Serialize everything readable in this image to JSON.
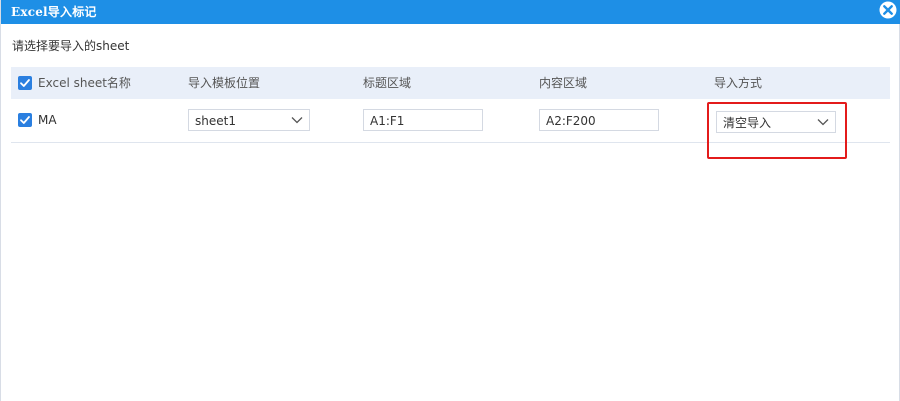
{
  "dialog": {
    "title": "Excel导入标记",
    "instruction": "请选择要导入的sheet"
  },
  "table": {
    "headers": {
      "sheet_name": "Excel sheet名称",
      "template_position": "导入模板位置",
      "title_area": "标题区域",
      "content_area": "内容区域",
      "import_mode": "导入方式"
    },
    "rows": [
      {
        "checked": true,
        "sheet_name": "MA",
        "template_position": "sheet1",
        "title_area": "A1:F1",
        "content_area": "A2:F200",
        "import_mode": "清空导入"
      }
    ]
  },
  "colors": {
    "titlebar": "#1e8fe6",
    "header_bg": "#e9eff9",
    "checkbox": "#2a7fe0",
    "highlight": "#e31b1b"
  }
}
